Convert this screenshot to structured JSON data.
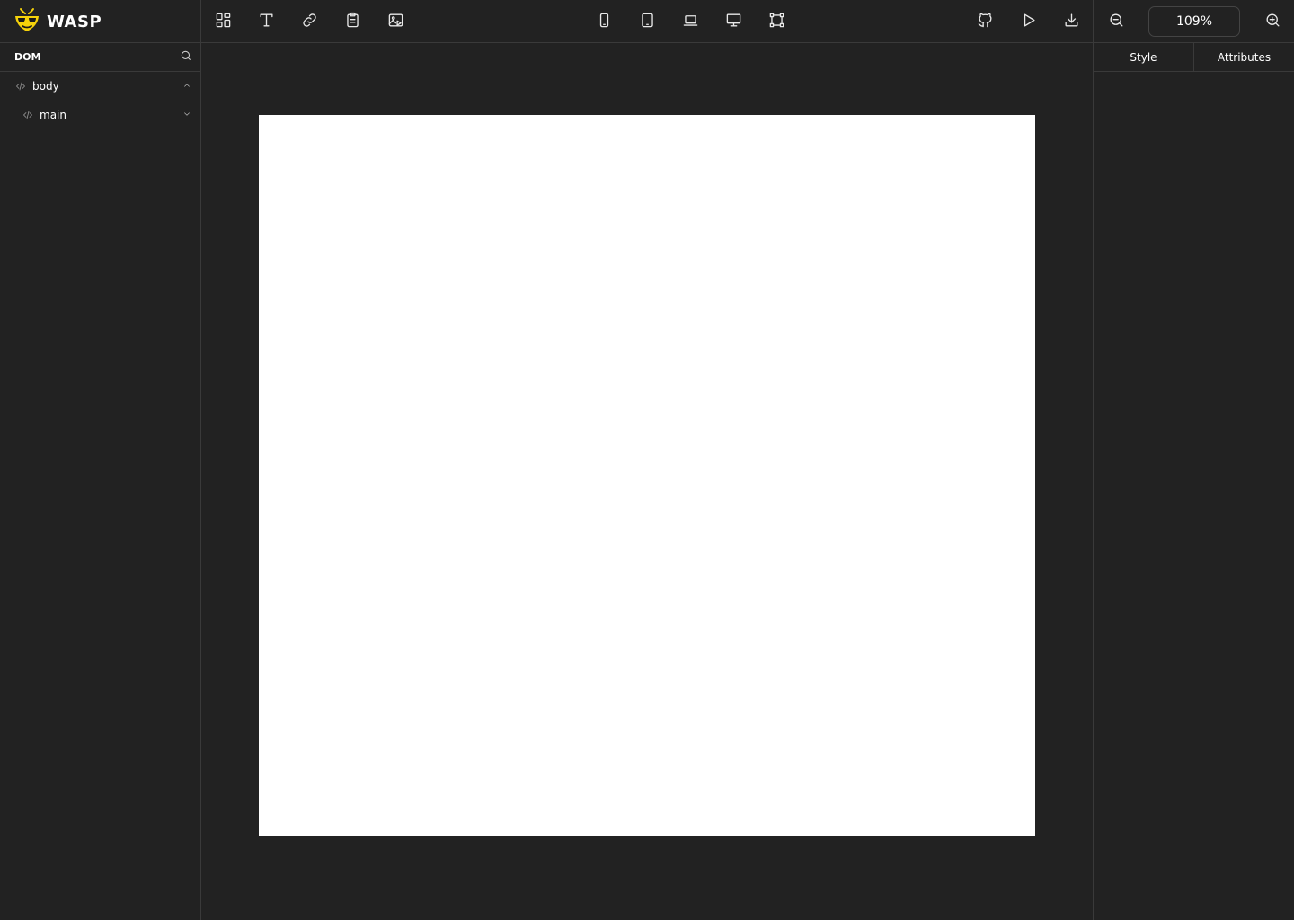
{
  "app": {
    "name": "WASP"
  },
  "toolbar": {
    "left_tools": [
      {
        "name": "components-icon"
      },
      {
        "name": "text-icon"
      },
      {
        "name": "link-icon"
      },
      {
        "name": "clipboard-icon"
      },
      {
        "name": "media-icon"
      }
    ],
    "device_tools": [
      {
        "name": "mobile-icon"
      },
      {
        "name": "tablet-icon"
      },
      {
        "name": "laptop-icon"
      },
      {
        "name": "desktop-icon"
      },
      {
        "name": "custom-size-icon"
      }
    ],
    "right_tools": [
      {
        "name": "github-icon"
      },
      {
        "name": "play-icon"
      },
      {
        "name": "download-icon"
      }
    ]
  },
  "zoom": {
    "value": "109%"
  },
  "sidebar": {
    "title": "DOM",
    "tree": [
      {
        "label": "body",
        "expanded": true
      },
      {
        "label": "main",
        "expanded": false
      }
    ]
  },
  "right_panel": {
    "tabs": [
      {
        "label": "Style"
      },
      {
        "label": "Attributes"
      }
    ]
  },
  "colors": {
    "background": "#222222",
    "border": "#3a3a3a",
    "canvas_frame": "#ffffff",
    "brand_accent": "#f5d20a"
  }
}
